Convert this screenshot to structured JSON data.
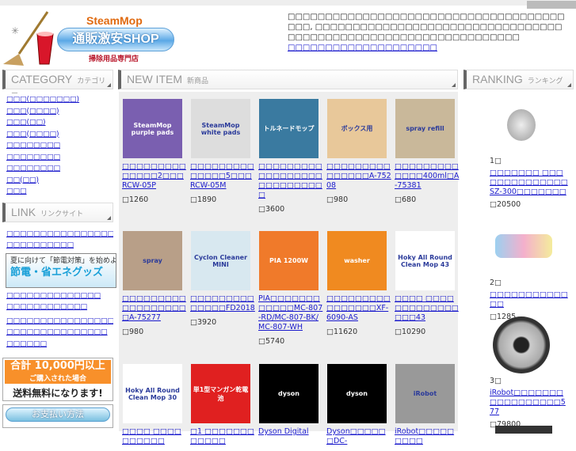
{
  "header": {
    "brand": "SteamMop",
    "shop_name": "通販激安SHOP",
    "subtitle": "掃除用品専門店",
    "intro": "□□□□□□□□□□□□□□□□□□□□□□□□□□□□□□□□□□□□□□□□, □□□□□□□□□□□□□□□□□□□□□□□□□□□□□□□□□□□□□□□□□□□□□□□□□□□□□□□□□□□□□□□□",
    "intro_link": "□□□□□□□□□□□□□□□□□□□□"
  },
  "sections": {
    "category": {
      "title": "CATEGORY",
      "sub": "カテゴリー"
    },
    "new": {
      "title": "NEW ITEM",
      "sub": "新商品"
    },
    "ranking": {
      "title": "RANKING",
      "sub": "ランキング"
    },
    "link": {
      "title": "LINK",
      "sub": "リンクサイト"
    }
  },
  "categories": [
    "□□□(□□□□□□□)",
    "□□□(□□□□)",
    "□□□(□□)",
    "□□□(□□□□)",
    "□□□□□□□□",
    "□□□□□□□□",
    "□□□□□□□□",
    "□□(□□)",
    "□□□"
  ],
  "links": [
    "□□□□□□□□□□□□□□□□□",
    "□□□□□□□□□□"
  ],
  "banner": {
    "line1": "夏に向けて「節電対策」を始めよう!",
    "line2": "節電・省エネグッズ"
  },
  "links2": [
    "□□□□□□□□□□□□□□",
    "□□□□□□□□□□□□"
  ],
  "links3": [
    "□□□□□□□□□□□□□□□□□□□□□□□□□□□□□",
    "□□□□□□□□□□□□□□□",
    "□□□□□□"
  ],
  "promo": {
    "line1": "合計 10,000円以上",
    "line2": "ご購入された場合",
    "line3": "送料無料になります!"
  },
  "payment": "お支払い方法",
  "items": [
    {
      "name": "□□□□□□□□□□□□□□2□□□RCW-05P",
      "price": "□1260",
      "img": "SteamMop purple pads",
      "color": "#7a5fb0"
    },
    {
      "name": "□□□□□□□□□□□□□□5□□□RCW-05M",
      "price": "□1890",
      "img": "SteamMop white pads",
      "color": "#ddd"
    },
    {
      "name": "□□□□□□□□□□□□□□□□□□□□□□□□□□□□",
      "price": "□3600",
      "img": "トルネードモップ",
      "color": "#3a7aa0"
    },
    {
      "name": "□□□□□□□□□□□□□□□A-75208",
      "price": "□980",
      "img": "ボックス用",
      "color": "#e8c89a"
    },
    {
      "name": "□□□□□□□□□□□□□400ml□A-75381",
      "price": "□680",
      "img": "spray refill",
      "color": "#c9b89a"
    },
    {
      "name": "□□□□□□□□□□□□□□□□□□□A-75277",
      "price": "□980",
      "img": "spray",
      "color": "#b89f88"
    },
    {
      "name": "□□□□□□□□□□□□□□FD2018",
      "price": "□3920",
      "img": "Cyclon Cleaner MINI",
      "color": "#d8e8f0"
    },
    {
      "name": "PIA□□□□□□□□□□□□MC-807-RD/MC-807-BK/MC-807-WH",
      "price": "□5740",
      "img": "PIA 1200W",
      "color": "#f07a2a"
    },
    {
      "name": "□□□□□□□□□□□□□□□□XF-6090-AS",
      "price": "□11620",
      "img": "washer",
      "color": "#f08a20"
    },
    {
      "name": "□□□□ □□□□□□□□□□□□□□□□43",
      "price": "□10290",
      "img": "Hoky All Round Clean Mop 43",
      "color": "#fff"
    },
    {
      "name": "□□□□ □□□□□□□□□□",
      "price": "",
      "img": "Hoky All Round Clean Mop 30",
      "color": "#fff"
    },
    {
      "name": "□1 □□□□□□□□□□□□",
      "price": "",
      "img": "単1型マンガン乾電池",
      "color": "#e02020"
    },
    {
      "name": "Dyson Digital",
      "price": "",
      "img": "dyson",
      "color": "#000"
    },
    {
      "name": "Dyson□□□□□□DC-",
      "price": "",
      "img": "dyson",
      "color": "#000"
    },
    {
      "name": "iRobot□□□□□□□□□",
      "price": "",
      "img": "iRobot",
      "color": "#999"
    }
  ],
  "ranking": [
    {
      "rank": "1□",
      "name": "□□□□□□□ □□□□□□□□□□□□□□SZ-300□□□□□□□",
      "price": "□20500"
    },
    {
      "rank": "2□",
      "name": "□□□□□□□□□□□□□",
      "price": "□1285"
    },
    {
      "rank": "3□",
      "name": "iRobot□□□□□□□□□□□□□□□□□577",
      "price": "□79800"
    }
  ]
}
